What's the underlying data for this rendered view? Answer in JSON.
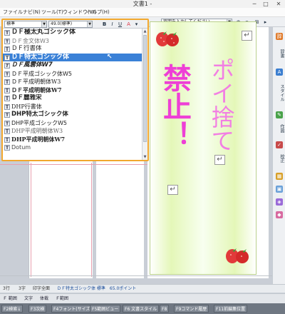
{
  "window": {
    "title": "文書1 -",
    "controls": [
      "─",
      "□",
      "✕"
    ]
  },
  "menu": {
    "items": [
      "ファイル",
      "ナビ(N)",
      "ツール(T)",
      "ウィンドウ(W)",
      "ヘルプ(H)"
    ]
  },
  "toolbar": {
    "style_value": "標準",
    "size_value": "49.0(標準)",
    "help_placeholder": "質問を入力してください"
  },
  "font_list": {
    "selected_index": 4,
    "items": [
      {
        "icon": "T",
        "name": "ＤＦ極太丸ゴシック体"
      },
      {
        "icon": "T",
        "name": "ＤＦ金文体W3"
      },
      {
        "icon": "T",
        "name": "ＤＦ行書体"
      },
      {
        "icon": "T",
        "name": "ＤＦ特太ゴシック体"
      },
      {
        "icon": "T",
        "name": "ＤＦ風雲体W7"
      },
      {
        "icon": "T",
        "name": "ＤＦ平成ゴシック体W5"
      },
      {
        "icon": "T",
        "name": "ＤＦ平成明朝体W3"
      },
      {
        "icon": "T",
        "name": "ＤＦ平成明朝体W7"
      },
      {
        "icon": "T",
        "name": "ＤＦ麗雅宋"
      },
      {
        "icon": "T",
        "name": "DHP行書体"
      },
      {
        "icon": "T",
        "name": "DHP特太ゴシック体"
      },
      {
        "icon": "T",
        "name": "DHP平成ゴシックW5"
      },
      {
        "icon": "T",
        "name": "DHP平成明朝体W3"
      },
      {
        "icon": "T",
        "name": "DHP平成明朝体W7"
      },
      {
        "icon": "T",
        "name": "Dotum"
      }
    ]
  },
  "poster": {
    "main_text": "禁止！",
    "sub_text": "ポイ捨て",
    "return_mark": "↵"
  },
  "right_panel": {
    "items": [
      "辞書",
      "スタイル",
      "作図",
      "校正"
    ]
  },
  "status": {
    "line": "3行",
    "col": "3字",
    "zoom": "印字全面",
    "font_info": "ＤＦ特太ゴシック体 標準　65.0ポイント"
  },
  "findbar": {
    "items": [
      "Ｆ 範囲",
      "文字",
      "体裁",
      "Ｆ範囲"
    ]
  },
  "fkeys": {
    "items": [
      "F2検索↓",
      "F3次検",
      "F4フォント(サイズ)",
      "F5範囲ビュー",
      "F6 文書スタイル",
      "F8",
      "F9コマンド履歴",
      "F11前編集位置"
    ]
  },
  "colors": {
    "selection": "#3a81d7",
    "dropdown_border": "#f2a82e",
    "poster_text": "#ee3fd6",
    "poster_bg": "#e4f7b8",
    "guide_lines": "#e8a0ae"
  }
}
